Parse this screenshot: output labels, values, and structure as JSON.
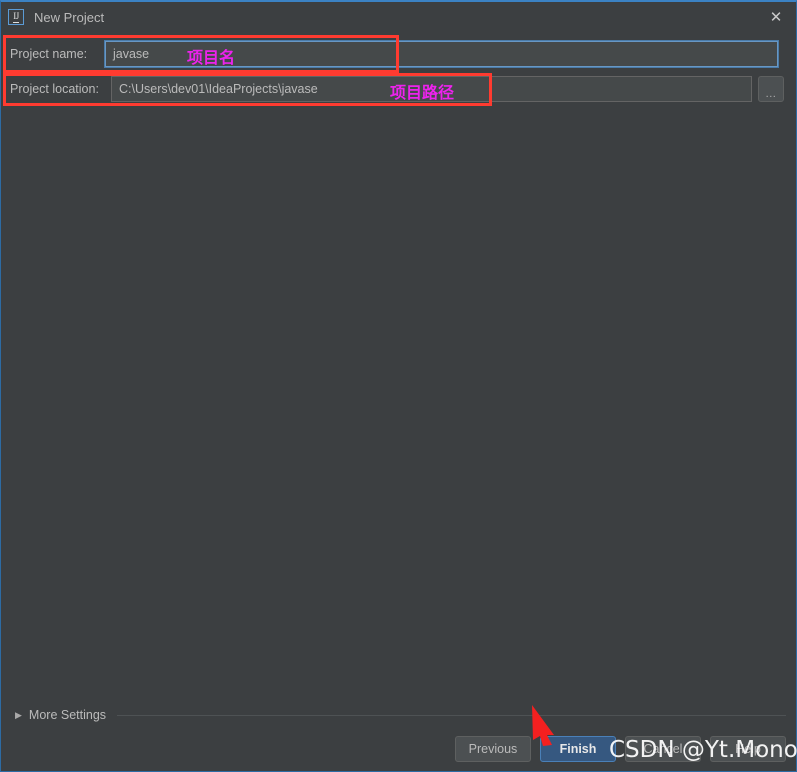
{
  "window": {
    "title": "New Project",
    "app_icon": "intellij-idea-icon",
    "close_icon": "✕",
    "accent_border": "#3b82c4",
    "background": "#3c3f41"
  },
  "form": {
    "name_row": {
      "label": "Project name:",
      "value": "javase",
      "placeholder": "",
      "focused": true
    },
    "location_row": {
      "label": "Project location:",
      "value": "C:\\Users\\dev01\\IdeaProjects\\javase",
      "placeholder": "",
      "browse_label": "..."
    }
  },
  "annotations": {
    "color_box": "#ff3b30",
    "color_text": "#ee22ee",
    "name_note": "项目名",
    "location_note": "项目路径",
    "arrow_color": "#f42020",
    "arrow_target": "Finish"
  },
  "more_settings": {
    "label": "More Settings",
    "arrow": "▶",
    "expanded": false
  },
  "buttons": {
    "previous": "Previous",
    "finish": "Finish",
    "cancel": "Cancel",
    "help": "Help",
    "primary_color": "#365880"
  },
  "watermark": {
    "text": "CSDN @Yt.Monody"
  }
}
